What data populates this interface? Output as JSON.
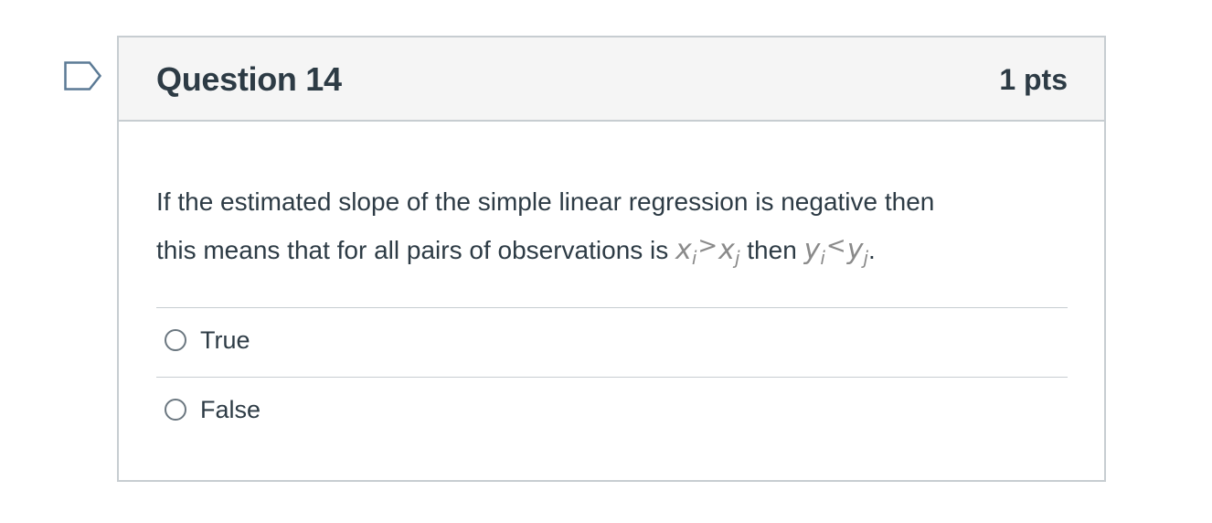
{
  "flag": {
    "icon": "flag-icon",
    "color": "#5b7a95"
  },
  "question": {
    "title": "Question 14",
    "points": "1 pts",
    "text_line1": "If the estimated slope of the simple linear regression is negative then",
    "text_line2_prefix": "this means that for all pairs of observations is",
    "text_middle": "then",
    "text_end": ".",
    "math1": {
      "left_var": "x",
      "left_sub": "i",
      "operator": ">",
      "right_var": "x",
      "right_sub": "j"
    },
    "math2": {
      "left_var": "y",
      "left_sub": "i",
      "operator": "<",
      "right_var": "y",
      "right_sub": "j"
    }
  },
  "answers": [
    {
      "label": "True",
      "selected": false
    },
    {
      "label": "False",
      "selected": false
    }
  ],
  "colors": {
    "text": "#2d3b45",
    "header_bg": "#f5f5f5",
    "border": "#c7cdd1",
    "math": "#8a8a8a"
  }
}
